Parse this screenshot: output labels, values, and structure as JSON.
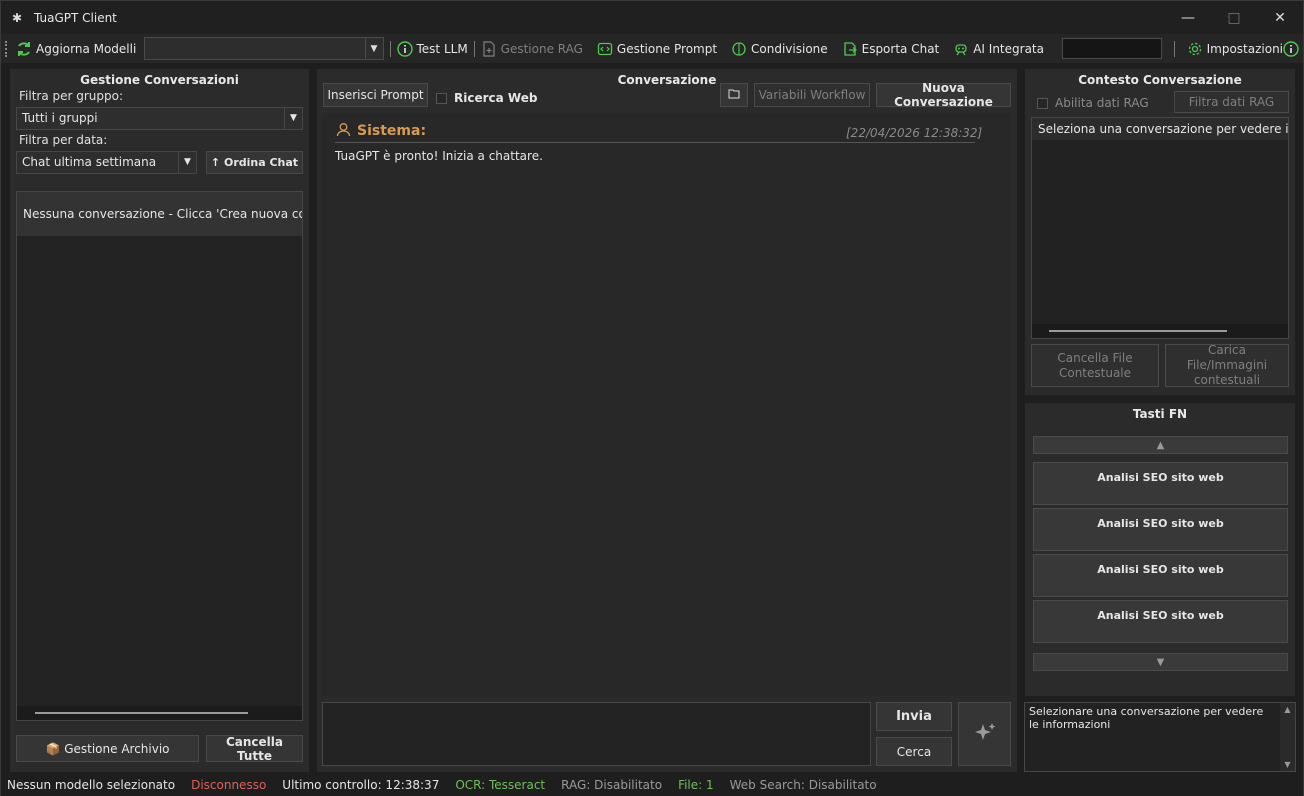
{
  "window": {
    "title": "TuaGPT Client"
  },
  "toolbar": {
    "refresh_models": "Aggiorna Modelli",
    "model_select_value": "",
    "test_llm": "Test LLM",
    "rag_management": "Gestione RAG",
    "prompt_management": "Gestione Prompt",
    "sharing": "Condivisione",
    "export_chat": "Esporta Chat",
    "ai_integrated": "AI Integrata",
    "settings": "Impostazioni"
  },
  "left_panel": {
    "title": "Gestione Conversazioni",
    "group_filter_label": "Filtra per gruppo:",
    "group_filter_value": "Tutti i gruppi",
    "date_filter_label": "Filtra per data:",
    "date_filter_value": "Chat ultima settimana",
    "sort_button": "↑ Ordina Chat",
    "empty_item": "Nessuna conversazione - Clicca 'Crea nuova conversazione'",
    "archive_button": "📦 Gestione Archivio",
    "delete_all_button": "Cancella Tutte"
  },
  "center_panel": {
    "title": "Conversazione",
    "insert_prompt": "Inserisci Prompt",
    "web_search_label": "Ricerca Web",
    "workflow_vars": "Variabili Workflow",
    "new_conversation": "Nuova Conversazione",
    "message": {
      "sender": "Sistema:",
      "timestamp": "[22/04/2026 12:38:32]",
      "text": "TuaGPT è pronto! Inizia a chattare."
    },
    "send_button": "Invia",
    "search_button": "Cerca"
  },
  "right_panel": {
    "title": "Contesto Conversazione",
    "enable_rag_label": "Abilita dati RAG",
    "filter_rag_button": "Filtra dati RAG",
    "context_text": "Seleziona una conversazione per vedere i fi...",
    "delete_file_button": "Cancella File Contestuale",
    "upload_file_button": "Carica File/Immagini contestuali",
    "fn_title": "Tasti FN",
    "fn_buttons": [
      "Analisi SEO sito web",
      "Analisi SEO sito web",
      "Analisi SEO sito web",
      "Analisi SEO sito web"
    ],
    "info_text": "Selezionare una conversazione per vedere le informazioni"
  },
  "status": {
    "model": "Nessun modello selezionato",
    "connection": "Disconnesso",
    "last_check": "Ultimo controllo: 12:38:37",
    "ocr": "OCR: Tesseract",
    "rag": "RAG: Disabilitato",
    "files": "File: 1",
    "web_search": "Web Search: Disabilitato"
  },
  "colors": {
    "accent_green": "#4ec94e",
    "system_orange": "#d99a52",
    "disconnected_red": "#e0605a",
    "status_green": "#6fbf5a"
  }
}
